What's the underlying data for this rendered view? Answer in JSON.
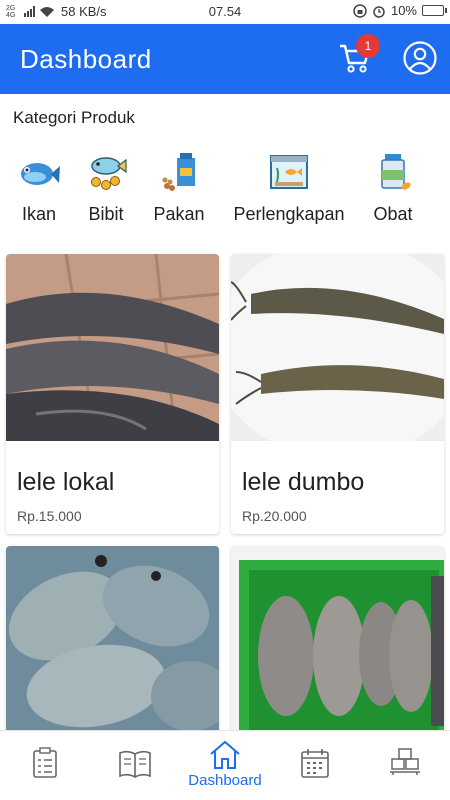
{
  "status_bar": {
    "network": "2G 4G",
    "speed": "58 KB/s",
    "time": "07.54",
    "battery": "10%"
  },
  "app_bar": {
    "title": "Dashboard",
    "cart_count": "1"
  },
  "category": {
    "title": "Kategori Produk",
    "items": [
      {
        "label": "Ikan",
        "icon": "fish-icon"
      },
      {
        "label": "Bibit",
        "icon": "fish-seed-icon"
      },
      {
        "label": "Pakan",
        "icon": "fish-feed-icon"
      },
      {
        "label": "Perlengkapan",
        "icon": "aquarium-icon"
      },
      {
        "label": "Obat",
        "icon": "medicine-bottle-icon"
      }
    ]
  },
  "products": [
    {
      "name": "lele lokal",
      "price": "Rp.15.000"
    },
    {
      "name": "lele dumbo",
      "price": "Rp.20.000"
    },
    {
      "name": "",
      "price": ""
    },
    {
      "name": "",
      "price": ""
    }
  ],
  "bottom_nav": {
    "items": [
      {
        "icon": "clipboard-list-icon",
        "label": ""
      },
      {
        "icon": "book-icon",
        "label": ""
      },
      {
        "icon": "home-icon",
        "label": "Dashboard"
      },
      {
        "icon": "calendar-icon",
        "label": ""
      },
      {
        "icon": "boxes-icon",
        "label": ""
      }
    ]
  },
  "colors": {
    "primary": "#1e6cf0",
    "badge": "#e53935"
  }
}
